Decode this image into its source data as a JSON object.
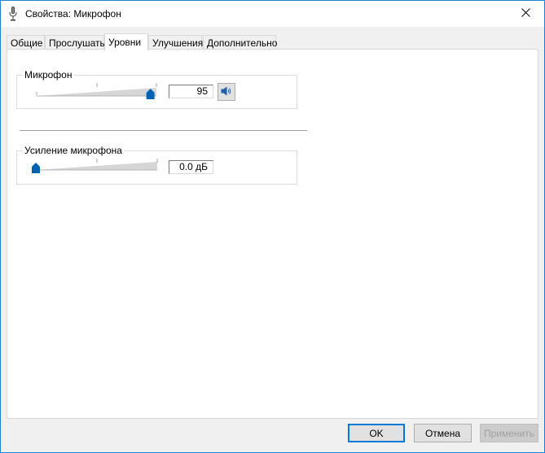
{
  "window": {
    "title": "Свойства: Микрофон",
    "title_icon": "microphone-icon",
    "close_icon": "close-icon"
  },
  "tabs": [
    {
      "label": "Общие",
      "active": false
    },
    {
      "label": "Прослушать",
      "active": false
    },
    {
      "label": "Уровни",
      "active": true
    },
    {
      "label": "Улучшения",
      "active": false
    },
    {
      "label": "Дополнительно",
      "active": false
    }
  ],
  "levels": {
    "microphone": {
      "label": "Микрофон",
      "value": "95",
      "level_percent": 95,
      "speaker_icon": "speaker-icon"
    },
    "boost": {
      "label": "Усиление микрофона",
      "value": "0.0 дБ",
      "level_percent": 0
    }
  },
  "buttons": {
    "ok": "OK",
    "cancel": "Отмена",
    "apply": "Применить"
  },
  "colors": {
    "accent": "#0078d7",
    "thumb": "#0063b1",
    "slider_track": "#d6d6d6"
  }
}
